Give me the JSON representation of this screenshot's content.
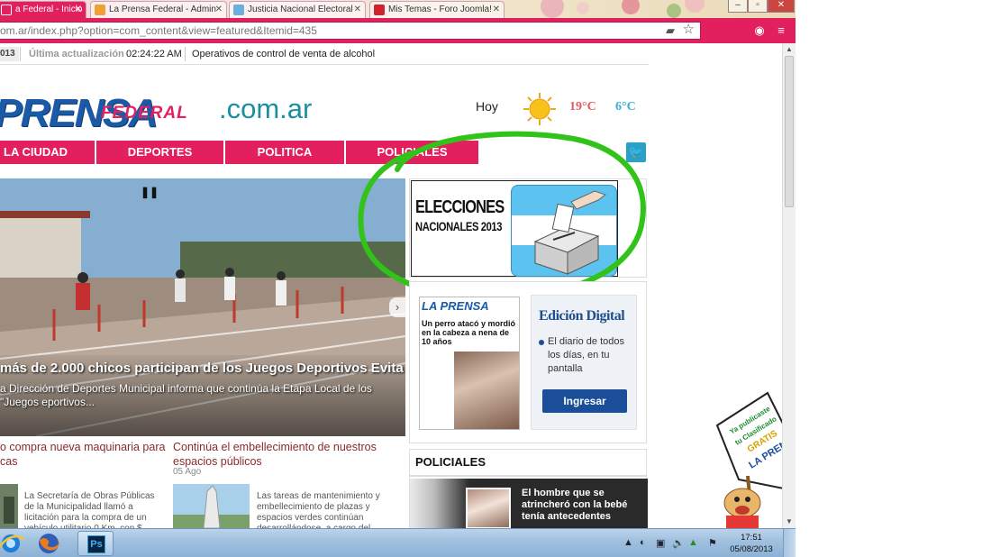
{
  "browser": {
    "tabs": [
      {
        "label": "a Federal - Inicio",
        "active": true
      },
      {
        "label": "La Prensa Federal - Admin",
        "active": false
      },
      {
        "label": "Justicia Nacional Electoral",
        "active": false
      },
      {
        "label": "Mis Temas - Foro Joomla!",
        "active": false
      }
    ],
    "url": "om.ar/index.php?option=com_content&view=featured&Itemid=435",
    "accent": "#e2205e"
  },
  "ticker": {
    "date": "013",
    "label": "Última actualización",
    "time": "02:24:22 AM",
    "news": "Operativos de control de venta de alcohol"
  },
  "logo": {
    "main": "PRENSA",
    "federal": "FEDERAL",
    "domain": ".com.ar"
  },
  "weather": {
    "day": "Hoy",
    "max": "19°C",
    "min": "6°C",
    "icon": "sun-icon"
  },
  "nav": [
    {
      "label": "LA CIUDAD"
    },
    {
      "label": "DEPORTES"
    },
    {
      "label": "POLITICA"
    },
    {
      "label": "POLICIALES"
    }
  ],
  "slider": {
    "title": "más de 2.000 chicos participan de los Juegos Deportivos Evita",
    "text": "a Dirección de Deportes Municipal informa que continúa la Etapa Local de los \"Juegos eportivos..."
  },
  "articles": [
    {
      "title": "o compra nueva maquinaria para cas",
      "date": "",
      "text": "La Secretaría de Obras Públicas de la Municipalidad llamó a licitación para la compra de un vehículo utilitario 0 Km. con $"
    },
    {
      "title": "Continúa el embellecimiento de nuestros espacios públicos",
      "date": "05 Ago",
      "text": "Las tareas de mantenimiento y embellecimiento de plazas y espacios verdes continúan desarrollándose, a cargo del"
    }
  ],
  "banner": {
    "line1": "ELECCIONES",
    "line2": "NACIONALES 2013"
  },
  "digital": {
    "paper_mast": "LA PRENSA",
    "paper_headline": "Un perro atacó y mordió en la cabeza a nena de 10 años",
    "title": "Edición Digital",
    "desc": "El diario de todos los días, en tu pantalla",
    "button": "Ingresar"
  },
  "policiales": {
    "header": "POLICIALES",
    "headline": "El hombre que se atrincheró con la bebé tenía antecedentes"
  },
  "mascot": {
    "sign": "Ya publicaste tu Clasificado GRATIS? LA PRENSA"
  },
  "taskbar": {
    "time": "17:51",
    "date": "05/08/2013"
  }
}
